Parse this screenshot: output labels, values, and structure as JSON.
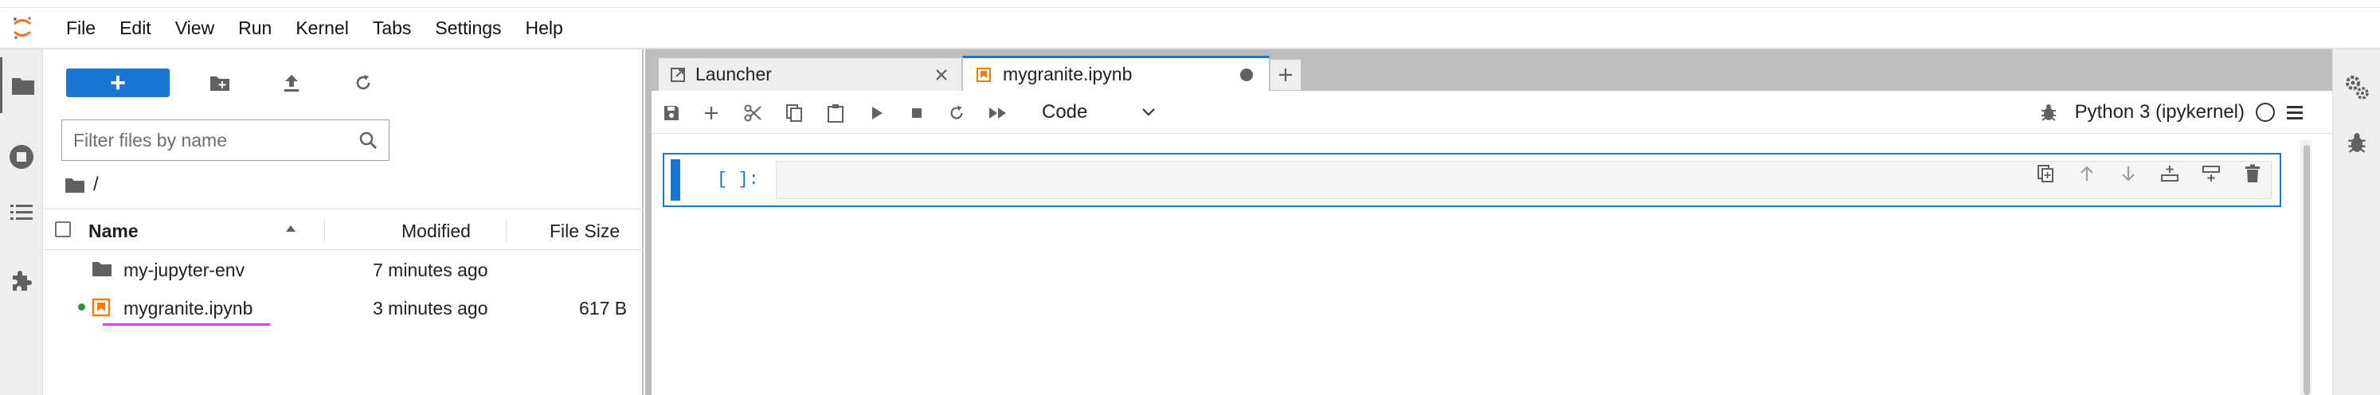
{
  "menu": {
    "items": [
      "File",
      "Edit",
      "View",
      "Run",
      "Kernel",
      "Tabs",
      "Settings",
      "Help"
    ]
  },
  "activity_bar": {
    "items": [
      "folder-icon",
      "running-icon",
      "toc-icon",
      "extension-icon"
    ]
  },
  "file_browser": {
    "new_label": "+",
    "filter_placeholder": "Filter files by name",
    "breadcrumb": "/",
    "columns": {
      "name": "Name",
      "modified": "Modified",
      "size": "File Size"
    },
    "files": [
      {
        "name": "my-jupyter-env",
        "modified": "7 minutes ago",
        "size": "",
        "type": "folder"
      },
      {
        "name": "mygranite.ipynb",
        "modified": "3 minutes ago",
        "size": "617 B",
        "type": "notebook",
        "running": true
      }
    ]
  },
  "tabs": [
    {
      "label": "Launcher",
      "active": false
    },
    {
      "label": "mygranite.ipynb",
      "active": true
    }
  ],
  "notebook": {
    "cell_type": "Code",
    "kernel_name": "Python 3 (ipykernel)",
    "cells": [
      {
        "prompt": "[ ]:",
        "source": ""
      }
    ]
  },
  "colors": {
    "accent": "#1976d2",
    "running": "#388e3c",
    "notebook_icon": "#f57c00",
    "underline": "#e040fb"
  }
}
